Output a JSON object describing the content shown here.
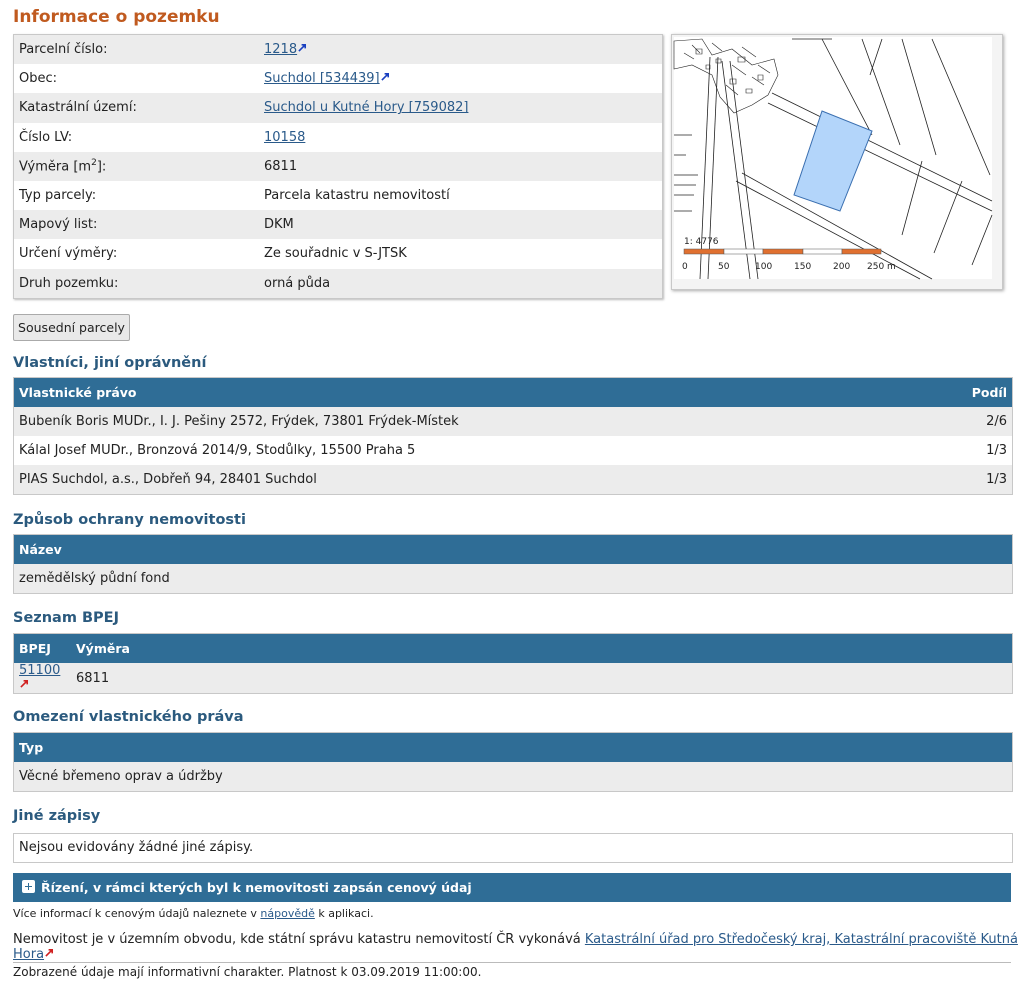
{
  "title": "Informace o pozemku",
  "info_rows": [
    {
      "label": "Parcelní číslo:",
      "value": "1218",
      "link": true,
      "ext": true
    },
    {
      "label": "Obec:",
      "value": "Suchdol [534439]",
      "link": true,
      "ext": true
    },
    {
      "label": "Katastrální území:",
      "value": "Suchdol u Kutné Hory [759082]",
      "link": true,
      "ext": false
    },
    {
      "label": "Číslo LV:",
      "value": "10158",
      "link": true,
      "ext": false
    },
    {
      "label_prefix": "Výměra [m",
      "label_sup": "2",
      "label_suffix": "]:",
      "value": "6811",
      "link": false
    },
    {
      "label": "Typ parcely:",
      "value": "Parcela katastru nemovitostí",
      "link": false
    },
    {
      "label": "Mapový list:",
      "value": "DKM",
      "link": false
    },
    {
      "label": "Určení výměry:",
      "value": "Ze souřadnic v S-JTSK",
      "link": false
    },
    {
      "label": "Druh pozemku:",
      "value": "orná půda",
      "link": false
    }
  ],
  "map": {
    "scale_ratio": "1: 4776",
    "scale_labels": [
      "0",
      "50",
      "100",
      "150",
      "200",
      "250 m"
    ],
    "parcel_color": "#b3d5fa",
    "scale_colors": [
      "#e07030",
      "#ffffff"
    ]
  },
  "neighbors_button": "Sousední parcely",
  "owners": {
    "heading": "Vlastníci, jiní oprávnění",
    "col_owner": "Vlastnické právo",
    "col_share": "Podíl",
    "rows": [
      {
        "name": "Bubeník Boris MUDr., I. J. Pešiny 2572, Frýdek, 73801 Frýdek-Místek",
        "share": "2/6"
      },
      {
        "name": "Kálal Josef MUDr., Bronzová 2014/9, Stodůlky, 15500 Praha 5",
        "share": "1/3"
      },
      {
        "name": "PIAS Suchdol, a.s., Dobřeň 94, 28401 Suchdol",
        "share": "1/3"
      }
    ]
  },
  "protection": {
    "heading": "Způsob ochrany nemovitosti",
    "col": "Název",
    "value": "zemědělský půdní fond"
  },
  "bpej": {
    "heading": "Seznam BPEJ",
    "col_code": "BPEJ",
    "col_area": "Výměra",
    "code": "51100",
    "area": "6811"
  },
  "restrictions": {
    "heading": "Omezení vlastnického práva",
    "col": "Typ",
    "value": "Věcné břemeno oprav a údržby"
  },
  "other": {
    "heading": "Jiné zápisy",
    "text": "Nejsou evidovány žádné jiné zápisy."
  },
  "price_bar": "Řízení, v rámci kterých byl k nemovitosti zapsán cenový údaj",
  "price_note": {
    "before": "Více informací k cenovým údajů naleznete v ",
    "link": "nápovědě",
    "after": " k aplikaci."
  },
  "office": {
    "text": "Nemovitost je v územním obvodu, kde státní správu katastru nemovitostí ČR vykonává ",
    "link": "Katastrální úřad pro Středočeský kraj, Katastrální pracoviště Kutná Hora"
  },
  "validity": "Zobrazené údaje mají informativní charakter. Platnost k 03.09.2019 11:00:00.",
  "colors": {
    "heading_orange": "#c05a1f",
    "heading_blue": "#2b5a7e",
    "table_header": "#2f6d96",
    "link": "#2a5a8a",
    "ext_blue": "#1a40c0",
    "ext_red": "#d02020"
  }
}
